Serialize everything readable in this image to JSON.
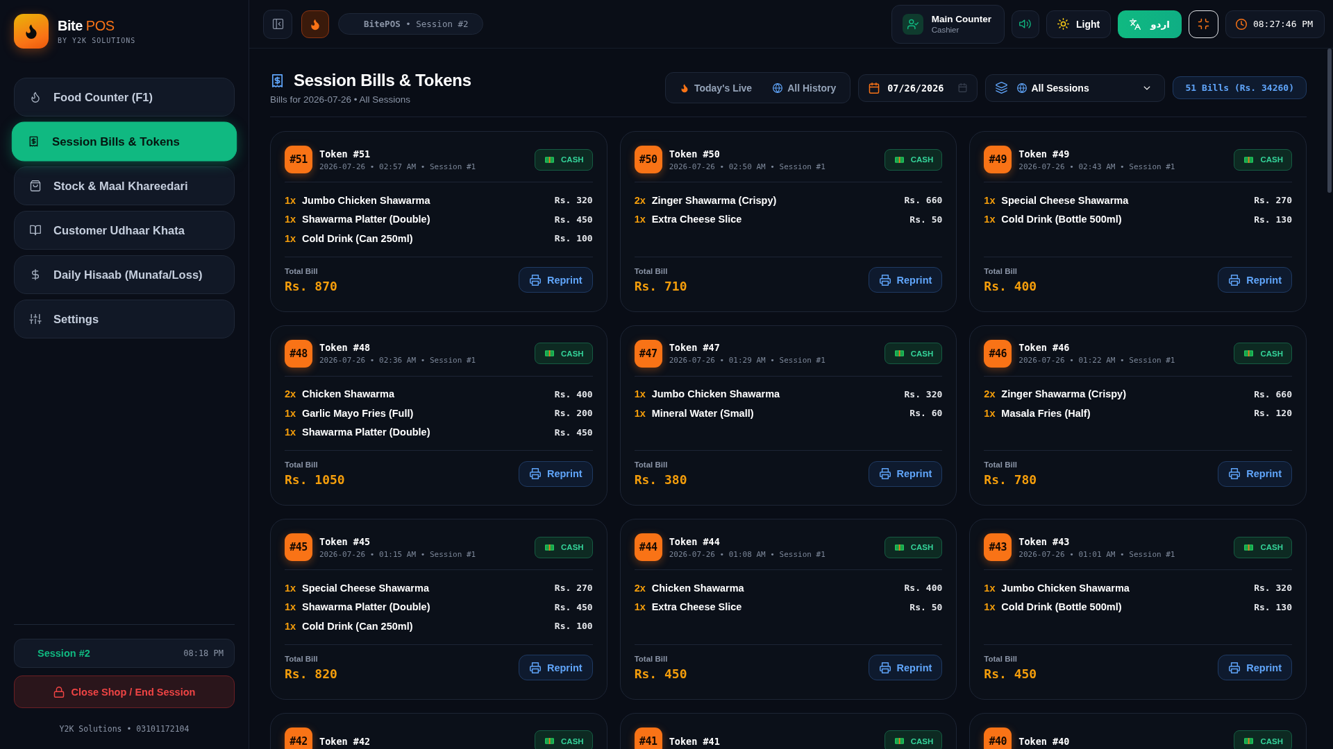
{
  "sidebar": {
    "brand": {
      "name": "Bite",
      "name_accent": "POS",
      "tagline": "BY Y2K SOLUTIONS"
    },
    "nav": [
      {
        "label": "Food Counter (F1)",
        "selected": false
      },
      {
        "label": "Session Bills & Tokens",
        "selected": true
      },
      {
        "label": "Stock & Maal Khareedari",
        "selected": false
      },
      {
        "label": "Customer Udhaar Khata",
        "selected": false
      },
      {
        "label": "Daily Hisaab (Munafa/Loss)",
        "selected": false
      },
      {
        "label": "Settings",
        "selected": false
      }
    ],
    "session": {
      "label": "Session #2",
      "time": "08:18 PM"
    },
    "end_button": "Close Shop / End Session",
    "footer": "Y2K Solutions • 03101172104"
  },
  "topbar": {
    "breadcrumb": "**BitePOS** • Session #2",
    "user": {
      "name": "Main Counter",
      "role": "Cashier"
    },
    "theme_button": "Light",
    "language_button": "اردو",
    "clock": "08:27:46 PM"
  },
  "header": {
    "title": "Session Bills & Tokens",
    "subtitle": "Bills for 2026-07-26 • All Sessions",
    "filters": [
      {
        "label": "Today's Live",
        "selected": false
      },
      {
        "label": "All History",
        "selected": false
      }
    ],
    "date": "07/26/2026",
    "session_select": "All Sessions",
    "summary": "51 Bills (Rs. 34260)"
  },
  "bills": [
    {
      "badge": "#51",
      "title": "Token #51",
      "meta": "2026-07-26 • 02:57 AM • Session #1",
      "payment": "CASH",
      "items": [
        {
          "qty": "1x",
          "name": "Jumbo Chicken Shawarma",
          "price": "Rs. 320"
        },
        {
          "qty": "1x",
          "name": "Shawarma Platter (Double)",
          "price": "Rs. 450"
        },
        {
          "qty": "1x",
          "name": "Cold Drink (Can 250ml)",
          "price": "Rs. 100"
        }
      ],
      "total_label": "Total Bill",
      "total": "Rs. 870",
      "action": "Reprint"
    },
    {
      "badge": "#50",
      "title": "Token #50",
      "meta": "2026-07-26 • 02:50 AM • Session #1",
      "payment": "CASH",
      "items": [
        {
          "qty": "2x",
          "name": "Zinger Shawarma (Crispy)",
          "price": "Rs. 660"
        },
        {
          "qty": "1x",
          "name": "Extra Cheese Slice",
          "price": "Rs. 50"
        }
      ],
      "total_label": "Total Bill",
      "total": "Rs. 710",
      "action": "Reprint"
    },
    {
      "badge": "#49",
      "title": "Token #49",
      "meta": "2026-07-26 • 02:43 AM • Session #1",
      "payment": "CASH",
      "items": [
        {
          "qty": "1x",
          "name": "Special Cheese Shawarma",
          "price": "Rs. 270"
        },
        {
          "qty": "1x",
          "name": "Cold Drink (Bottle 500ml)",
          "price": "Rs. 130"
        }
      ],
      "total_label": "Total Bill",
      "total": "Rs. 400",
      "action": "Reprint"
    },
    {
      "badge": "#48",
      "title": "Token #48",
      "meta": "2026-07-26 • 02:36 AM • Session #1",
      "payment": "CASH",
      "items": [
        {
          "qty": "2x",
          "name": "Chicken Shawarma",
          "price": "Rs. 400"
        },
        {
          "qty": "1x",
          "name": "Garlic Mayo Fries (Full)",
          "price": "Rs. 200"
        },
        {
          "qty": "1x",
          "name": "Shawarma Platter (Double)",
          "price": "Rs. 450"
        }
      ],
      "total_label": "Total Bill",
      "total": "Rs. 1050",
      "action": "Reprint"
    },
    {
      "badge": "#47",
      "title": "Token #47",
      "meta": "2026-07-26 • 01:29 AM • Session #1",
      "payment": "CASH",
      "items": [
        {
          "qty": "1x",
          "name": "Jumbo Chicken Shawarma",
          "price": "Rs. 320"
        },
        {
          "qty": "1x",
          "name": "Mineral Water (Small)",
          "price": "Rs. 60"
        }
      ],
      "total_label": "Total Bill",
      "total": "Rs. 380",
      "action": "Reprint"
    },
    {
      "badge": "#46",
      "title": "Token #46",
      "meta": "2026-07-26 • 01:22 AM • Session #1",
      "payment": "CASH",
      "items": [
        {
          "qty": "2x",
          "name": "Zinger Shawarma (Crispy)",
          "price": "Rs. 660"
        },
        {
          "qty": "1x",
          "name": "Masala Fries (Half)",
          "price": "Rs. 120"
        }
      ],
      "total_label": "Total Bill",
      "total": "Rs. 780",
      "action": "Reprint"
    },
    {
      "badge": "#45",
      "title": "Token #45",
      "meta": "2026-07-26 • 01:15 AM • Session #1",
      "payment": "CASH",
      "items": [
        {
          "qty": "1x",
          "name": "Special Cheese Shawarma",
          "price": "Rs. 270"
        },
        {
          "qty": "1x",
          "name": "Shawarma Platter (Double)",
          "price": "Rs. 450"
        },
        {
          "qty": "1x",
          "name": "Cold Drink (Can 250ml)",
          "price": "Rs. 100"
        }
      ],
      "total_label": "Total Bill",
      "total": "Rs. 820",
      "action": "Reprint"
    },
    {
      "badge": "#44",
      "title": "Token #44",
      "meta": "2026-07-26 • 01:08 AM • Session #1",
      "payment": "CASH",
      "items": [
        {
          "qty": "2x",
          "name": "Chicken Shawarma",
          "price": "Rs. 400"
        },
        {
          "qty": "1x",
          "name": "Extra Cheese Slice",
          "price": "Rs. 50"
        }
      ],
      "total_label": "Total Bill",
      "total": "Rs. 450",
      "action": "Reprint"
    },
    {
      "badge": "#43",
      "title": "Token #43",
      "meta": "2026-07-26 • 01:01 AM • Session #1",
      "payment": "CASH",
      "items": [
        {
          "qty": "1x",
          "name": "Jumbo Chicken Shawarma",
          "price": "Rs. 320"
        },
        {
          "qty": "1x",
          "name": "Cold Drink (Bottle 500ml)",
          "price": "Rs. 130"
        }
      ],
      "total_label": "Total Bill",
      "total": "Rs. 450",
      "action": "Reprint"
    },
    {
      "badge": "#42",
      "title": "Token #42",
      "payment": "CASH"
    },
    {
      "badge": "#41",
      "title": "Token #41",
      "payment": "CASH"
    },
    {
      "badge": "#40",
      "title": "Token #40",
      "payment": "CASH"
    }
  ]
}
